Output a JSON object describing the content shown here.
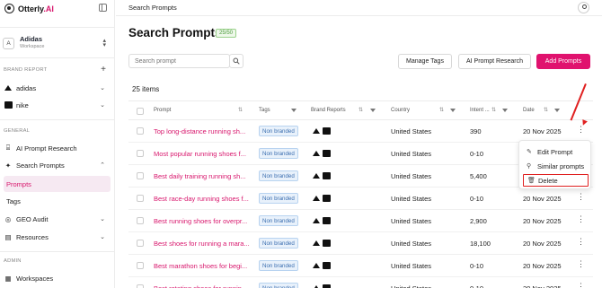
{
  "app": {
    "logo_text": "Otterly",
    "logo_accent": ".AI"
  },
  "workspace": {
    "initial": "A",
    "name": "Adidas",
    "subtitle": "Workspace"
  },
  "sidebar": {
    "brand_report_label": "BRAND REPORT",
    "brands": [
      {
        "label": "adidas",
        "icon": "adidas-logo"
      },
      {
        "label": "nike",
        "icon": "nike-logo"
      }
    ],
    "general_label": "GENERAL",
    "items": [
      {
        "label": "AI Prompt Research",
        "icon": "research-icon"
      },
      {
        "label": "Search Prompts",
        "icon": "search-prompts-icon"
      },
      {
        "label": "Prompts"
      },
      {
        "label": "Tags"
      },
      {
        "label": "GEO Audit",
        "icon": "audit-icon"
      },
      {
        "label": "Resources",
        "icon": "resources-icon"
      }
    ],
    "admin_label": "ADMIN",
    "admin_items": [
      {
        "label": "Workspaces",
        "icon": "workspaces-icon"
      }
    ]
  },
  "header": {
    "breadcrumb": "Search Prompts"
  },
  "main": {
    "title": "Search Prompts",
    "count_badge": "25/50",
    "search_placeholder": "Search prompt",
    "buttons": {
      "manage_tags": "Manage Tags",
      "ai_prompt_research": "AI Prompt Research",
      "add_prompts": "Add Prompts"
    },
    "items_count": "25 items"
  },
  "table": {
    "columns": [
      "Prompt",
      "Tags",
      "Brand Reports",
      "Country",
      "Intent ...",
      "Date"
    ],
    "rows": [
      {
        "prompt": "Top long-distance running sh...",
        "tag": "Non branded",
        "country": "United States",
        "intent": "390",
        "date": "20 Nov 2025"
      },
      {
        "prompt": "Most popular running shoes f...",
        "tag": "Non branded",
        "country": "United States",
        "intent": "0-10",
        "date": "20 Nov 2025"
      },
      {
        "prompt": "Best daily training running sh...",
        "tag": "Non branded",
        "country": "United States",
        "intent": "5,400",
        "date": "20 Nov 2025"
      },
      {
        "prompt": "Best race-day running shoes f...",
        "tag": "Non branded",
        "country": "United States",
        "intent": "0-10",
        "date": "20 Nov 2025"
      },
      {
        "prompt": "Best running shoes for overpr...",
        "tag": "Non branded",
        "country": "United States",
        "intent": "2,900",
        "date": "20 Nov 2025"
      },
      {
        "prompt": "Best shoes for running a mara...",
        "tag": "Non branded",
        "country": "United States",
        "intent": "18,100",
        "date": "20 Nov 2025"
      },
      {
        "prompt": "Best marathon shoes for begi...",
        "tag": "Non branded",
        "country": "United States",
        "intent": "0-10",
        "date": "20 Nov 2025"
      },
      {
        "prompt": "Best rotating shoes for runnin...",
        "tag": "Non branded",
        "country": "United States",
        "intent": "0-10",
        "date": "20 Nov 2025"
      }
    ]
  },
  "row_menu": {
    "items": [
      "Edit Prompt",
      "Similar prompts",
      "Delete"
    ]
  },
  "colors": {
    "accent": "#e0126e",
    "prompt_text": "#d8176d",
    "annotation": "#e02020"
  }
}
